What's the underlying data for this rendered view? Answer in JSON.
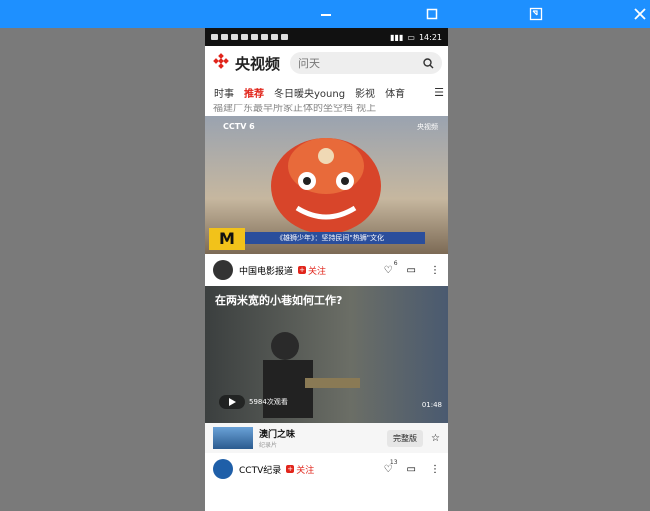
{
  "window": {
    "minimize_icon": "minimize-icon",
    "maximize_icon": "maximize-icon",
    "restore_icon": "restore-icon",
    "close_icon": "close-icon",
    "accent": "#1e90ff"
  },
  "statusbar": {
    "time": "14:21"
  },
  "header": {
    "app_name": "央视频",
    "search_placeholder": "问天",
    "brand_color": "#e1251b"
  },
  "tabs": [
    "时事",
    "推荐",
    "冬日暖央young",
    "影视",
    "体育"
  ],
  "active_tab": "推荐",
  "feed": {
    "cut_text": "福建广东最早所家正体的坐空档 视上",
    "video1": {
      "channel_tag": "CCTV 6",
      "source_tag": "央视频",
      "caption": "《雄狮少年》：坚持民间\"热狮\"文化",
      "corner_logo": "M"
    },
    "author1": {
      "name": "中国电影报道",
      "follow": "关注",
      "likes": "6"
    },
    "video2": {
      "title": "在两米宽的小巷如何工作?",
      "views": "5984次观看",
      "duration": "01:48"
    },
    "series": {
      "title": "澳门之味",
      "sub": "纪录片",
      "full_label": "完整版"
    },
    "author2": {
      "name": "CCTV纪录",
      "follow": "关注",
      "likes": "13"
    }
  }
}
